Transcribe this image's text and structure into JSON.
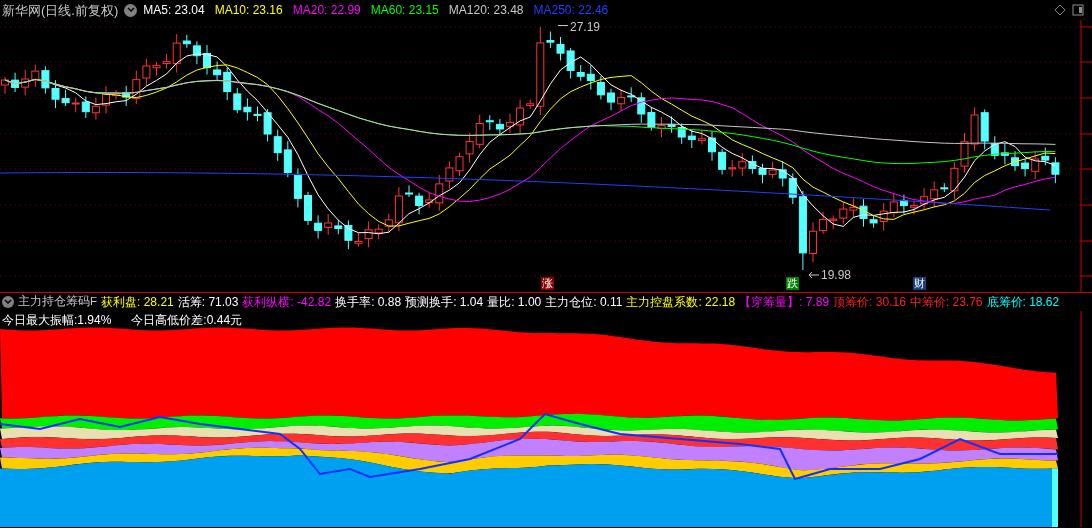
{
  "header": {
    "title": "新华网(日线.前复权)",
    "averages": [
      {
        "label": "MA5: 23.04",
        "color": "#ffffff"
      },
      {
        "label": "MA10: 23.16",
        "color": "#ffff00"
      },
      {
        "label": "MA20: 22.99",
        "color": "#ff00ff"
      },
      {
        "label": "MA60: 23.15",
        "color": "#00ff00"
      },
      {
        "label": "MA120: 23.48",
        "color": "#c8c8c8"
      },
      {
        "label": "MA250: 22.46",
        "color": "#2040ff"
      }
    ]
  },
  "price_chart": {
    "high_label": "27.19",
    "low_label": "19.98",
    "markers": [
      {
        "text": "涨",
        "color": "#8b0000"
      },
      {
        "text": "跌",
        "color": "#008000"
      },
      {
        "text": "财",
        "color": "#1a3f7a"
      }
    ]
  },
  "indicator": {
    "name": "主力持仓筹码F",
    "items": [
      {
        "label": "获利盘: 28.21",
        "color": "#ffff00"
      },
      {
        "label": "活筹: 71.03",
        "color": "#ffffff"
      },
      {
        "label": "获利纵横: -42.82",
        "color": "#ff00ff"
      },
      {
        "label": "换手率: 0.88",
        "color": "#ffffff"
      },
      {
        "label": "预测换手: 1.04",
        "color": "#ffffff"
      },
      {
        "label": "量比: 1.00",
        "color": "#ffffff"
      },
      {
        "label": "主力仓位: 0.11",
        "color": "#ffffff"
      },
      {
        "label": "主力控盘系数: 22.18",
        "color": "#ffff00"
      },
      {
        "label": "【穿筹量】: 7.89",
        "color": "#ff00ff"
      },
      {
        "label": "顶筹价: 30.16",
        "color": "#ff2020"
      },
      {
        "label": "中筹价: 23.76",
        "color": "#ff2020"
      },
      {
        "label": "底筹价: 18.62",
        "color": "#00ffff"
      }
    ],
    "notes": [
      "今日最大振幅:1.94%",
      "今日高低价差:0.44元"
    ]
  }
}
